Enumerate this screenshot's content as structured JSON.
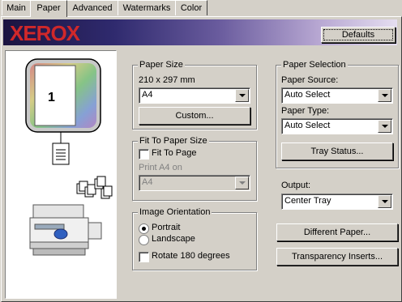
{
  "tabs": [
    "Main",
    "Paper",
    "Advanced",
    "Watermarks",
    "Color"
  ],
  "brand": {
    "logo_text": "XEROX",
    "logo_color": "#d0282a"
  },
  "defaults_button": "Defaults",
  "preview": {
    "page_number": "1"
  },
  "paper_size": {
    "group_label": "Paper Size",
    "dimensions": "210 x 297 mm",
    "selected": "A4",
    "custom_button": "Custom..."
  },
  "fit_to_paper": {
    "group_label": "Fit To Paper Size",
    "checkbox_label": "Fit To Page",
    "print_on_label": "Print A4 on",
    "selected": "A4"
  },
  "orientation": {
    "group_label": "Image Orientation",
    "portrait": "Portrait",
    "landscape": "Landscape",
    "rotate": "Rotate 180 degrees"
  },
  "paper_selection": {
    "group_label": "Paper Selection",
    "source_label": "Paper Source:",
    "source_selected": "Auto Select",
    "type_label": "Paper Type:",
    "type_selected": "Auto Select",
    "tray_status_button": "Tray Status..."
  },
  "output": {
    "label": "Output:",
    "selected": "Center Tray"
  },
  "different_paper_button": "Different Paper...",
  "transparency_button": "Transparency Inserts..."
}
